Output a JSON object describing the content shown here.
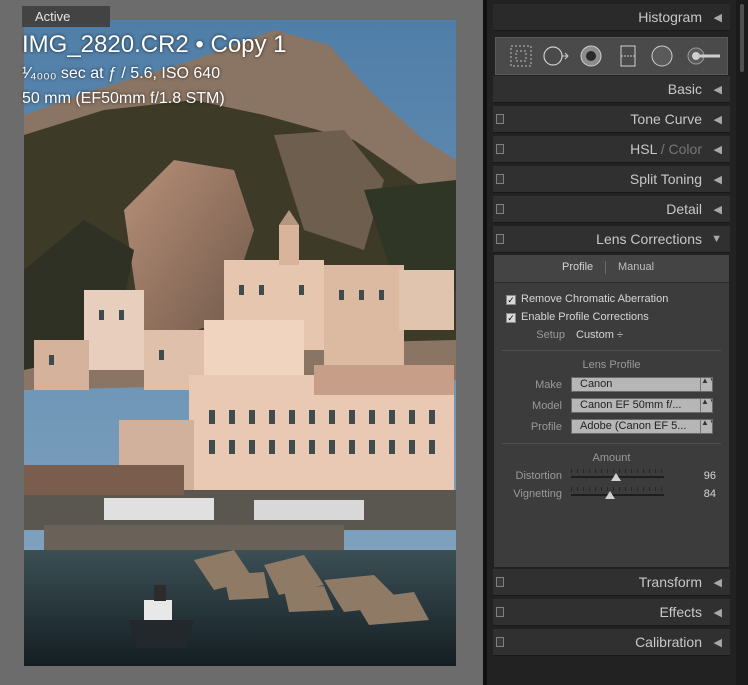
{
  "canvas": {
    "active_label": "Active",
    "overlay": {
      "filename": "IMG_2820.CR2 • Copy 1",
      "exposure": "¹⁄₄₀₀₀ sec at ƒ / 5.6, ISO 640",
      "lens": "50 mm (EF50mm f/1.8 STM)"
    }
  },
  "panel": {
    "histogram": "Histogram",
    "tools": [
      "crop-overlay-icon",
      "spot-removal-icon",
      "red-eye-icon",
      "graduated-filter-icon",
      "radial-filter-icon",
      "adjustment-brush-icon"
    ],
    "sections": {
      "basic": "Basic",
      "tone_curve": "Tone Curve",
      "hsl_a": "HSL",
      "hsl_sep": " / ",
      "hsl_b": "Color",
      "split_toning": "Split Toning",
      "detail": "Detail",
      "lens_corrections": "Lens Corrections",
      "transform": "Transform",
      "effects": "Effects",
      "calibration": "Calibration"
    },
    "collapse_glyph": "◀",
    "expand_glyph": "▼",
    "lens": {
      "tab_profile": "Profile",
      "tab_manual": "Manual",
      "remove_ca": "Remove Chromatic Aberration",
      "enable_profile": "Enable Profile Corrections",
      "check_glyph": "✓",
      "setup_label": "Setup",
      "setup_value": "Custom ÷",
      "profile_title": "Lens Profile",
      "make_label": "Make",
      "make_value": "Canon",
      "model_label": "Model",
      "model_value": "Canon EF 50mm f/...",
      "profile_label": "Profile",
      "profile_value": "Adobe (Canon EF 5...",
      "select_arrows": "▲▼",
      "amount_title": "Amount",
      "distortion_label": "Distortion",
      "distortion_value": "96",
      "distortion_level": 0.48,
      "vignetting_label": "Vignetting",
      "vignetting_value": "84",
      "vignetting_level": 0.42
    }
  }
}
